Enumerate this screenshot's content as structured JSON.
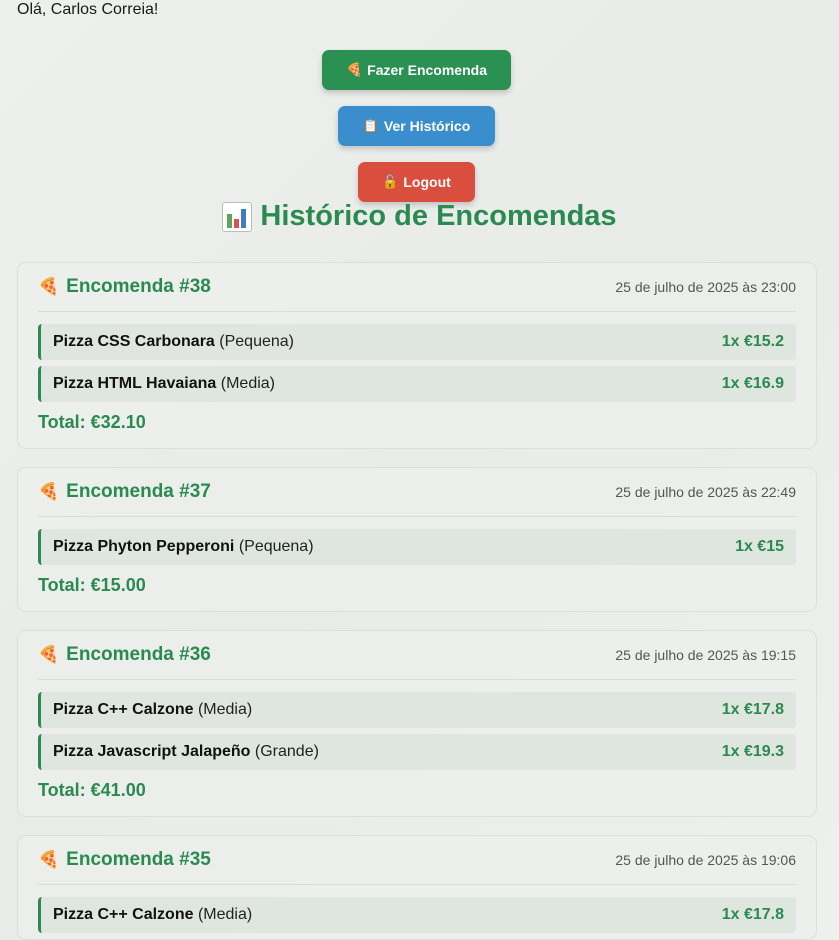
{
  "greeting": "Olá, Carlos Correia!",
  "buttons": {
    "order": {
      "icon": "🍕",
      "label": "Fazer Encomenda"
    },
    "history": {
      "icon": "📋",
      "label": "Ver Histórico"
    },
    "logout": {
      "icon": "🔓",
      "label": "Logout"
    }
  },
  "section_title": "Histórico de Encomendas",
  "section_icon": "bar-chart-icon",
  "orders": [
    {
      "title": "Encomenda #38",
      "date": "25 de julho de 2025 às 23:00",
      "items": [
        {
          "name": "Pizza CSS Carbonara",
          "size": "(Pequena)",
          "qty_price": "1x €15.2"
        },
        {
          "name": "Pizza HTML Havaiana",
          "size": "(Media)",
          "qty_price": "1x €16.9"
        }
      ],
      "total": "Total: €32.10"
    },
    {
      "title": "Encomenda #37",
      "date": "25 de julho de 2025 às 22:49",
      "items": [
        {
          "name": "Pizza Phyton Pepperoni",
          "size": "(Pequena)",
          "qty_price": "1x €15"
        }
      ],
      "total": "Total: €15.00"
    },
    {
      "title": "Encomenda #36",
      "date": "25 de julho de 2025 às 19:15",
      "items": [
        {
          "name": "Pizza C++ Calzone",
          "size": "(Media)",
          "qty_price": "1x €17.8"
        },
        {
          "name": "Pizza Javascript Jalapeño",
          "size": "(Grande)",
          "qty_price": "1x €19.3"
        }
      ],
      "total": "Total: €41.00"
    },
    {
      "title": "Encomenda #35",
      "date": "25 de julho de 2025 às 19:06",
      "items": [
        {
          "name": "Pizza C++ Calzone",
          "size": "(Media)",
          "qty_price": "1x €17.8"
        }
      ],
      "total": ""
    }
  ],
  "colors": {
    "primary_green": "#2a8a50",
    "order_button": "#2a9152",
    "history_button": "#3a8ecd",
    "logout_button": "#d94e3c"
  }
}
